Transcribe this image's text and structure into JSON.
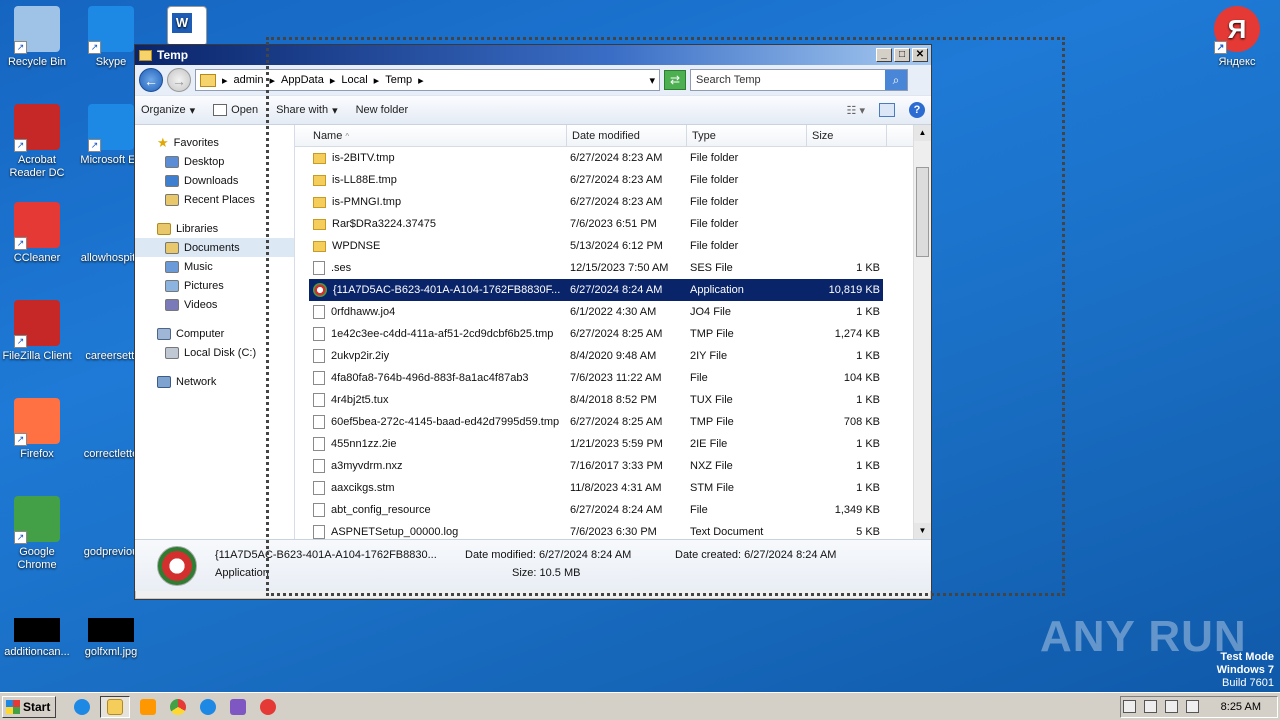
{
  "desktop": {
    "icons_left": [
      {
        "label": "Recycle Bin",
        "icon": "recycle-bin-icon",
        "color": "#9ec3e6"
      },
      {
        "label": "Acrobat Reader DC",
        "icon": "acrobat-icon",
        "color": "#c62828"
      },
      {
        "label": "CCleaner",
        "icon": "ccleaner-icon",
        "color": "#e53935"
      },
      {
        "label": "FileZilla Client",
        "icon": "filezilla-icon",
        "color": "#c62828"
      },
      {
        "label": "Firefox",
        "icon": "firefox-icon",
        "color": "#ff7043"
      },
      {
        "label": "Google Chrome",
        "icon": "chrome-icon",
        "color": "#43a047"
      },
      {
        "label": "additioncan...",
        "icon": "image-thumb-icon",
        "color": "#000000"
      }
    ],
    "icons_col2": [
      {
        "label": "Skype",
        "icon": "skype-icon",
        "color": "#1e88e5"
      },
      {
        "label": "Microsoft Ed",
        "icon": "edge-icon",
        "color": "#1e88e5"
      },
      {
        "label": "allowhospita",
        "icon": "file-icon",
        "color": "#1e78d0"
      },
      {
        "label": "careersetti",
        "icon": "file-icon",
        "color": "#1e78d0"
      },
      {
        "label": "correctlette",
        "icon": "file-icon",
        "color": "#1e78d0"
      },
      {
        "label": "godpreviou",
        "icon": "file-icon",
        "color": "#1e78d0"
      },
      {
        "label": "golfxml.jpg",
        "icon": "image-thumb-icon",
        "color": "#000000"
      }
    ],
    "icon_right": {
      "label": "Яндекс",
      "icon": "yandex-icon",
      "color": "#e53935"
    },
    "word_icon": "word-icon"
  },
  "window": {
    "title": "Temp",
    "breadcrumb": [
      "admin",
      "AppData",
      "Local",
      "Temp"
    ],
    "search_placeholder": "Search Temp",
    "toolbar": {
      "organize": "Organize",
      "open": "Open",
      "share": "Share with",
      "new_folder": "New folder"
    },
    "nav": {
      "favorites": "Favorites",
      "favorites_items": [
        "Desktop",
        "Downloads",
        "Recent Places"
      ],
      "libraries": "Libraries",
      "libraries_items": [
        "Documents",
        "Music",
        "Pictures",
        "Videos"
      ],
      "computer": "Computer",
      "computer_items": [
        "Local Disk (C:)"
      ],
      "network": "Network"
    },
    "columns": {
      "name": "Name",
      "date": "Date modified",
      "type": "Type",
      "size": "Size"
    },
    "files": [
      {
        "name": "is-2BITV.tmp",
        "date": "6/27/2024 8:23 AM",
        "type": "File folder",
        "size": "",
        "kind": "folder"
      },
      {
        "name": "is-LL88E.tmp",
        "date": "6/27/2024 8:23 AM",
        "type": "File folder",
        "size": "",
        "kind": "folder"
      },
      {
        "name": "is-PMNGI.tmp",
        "date": "6/27/2024 8:23 AM",
        "type": "File folder",
        "size": "",
        "kind": "folder"
      },
      {
        "name": "Rar$DRa3224.37475",
        "date": "7/6/2023 6:51 PM",
        "type": "File folder",
        "size": "",
        "kind": "folder"
      },
      {
        "name": "WPDNSE",
        "date": "5/13/2024 6:12 PM",
        "type": "File folder",
        "size": "",
        "kind": "folder"
      },
      {
        "name": ".ses",
        "date": "12/15/2023 7:50 AM",
        "type": "SES File",
        "size": "1 KB",
        "kind": "file"
      },
      {
        "name": "{11A7D5AC-B623-401A-A104-1762FB8830F...",
        "date": "6/27/2024 8:24 AM",
        "type": "Application",
        "size": "10,819 KB",
        "kind": "app",
        "selected": true
      },
      {
        "name": "0rfdhaww.jo4",
        "date": "6/1/2022 4:30 AM",
        "type": "JO4 File",
        "size": "1 KB",
        "kind": "file"
      },
      {
        "name": "1e42c3ee-c4dd-411a-af51-2cd9dcbf6b25.tmp",
        "date": "6/27/2024 8:25 AM",
        "type": "TMP File",
        "size": "1,274 KB",
        "kind": "file"
      },
      {
        "name": "2ukvp2ir.2iy",
        "date": "8/4/2020 9:48 AM",
        "type": "2IY File",
        "size": "1 KB",
        "kind": "file"
      },
      {
        "name": "4fa80fa8-764b-496d-883f-8a1ac4f87ab3",
        "date": "7/6/2023 11:22 AM",
        "type": "File",
        "size": "104 KB",
        "kind": "file"
      },
      {
        "name": "4r4bj2t5.tux",
        "date": "8/4/2018 8:52 PM",
        "type": "TUX File",
        "size": "1 KB",
        "kind": "file"
      },
      {
        "name": "60ef5bea-272c-4145-baad-ed42d7995d59.tmp",
        "date": "6/27/2024 8:25 AM",
        "type": "TMP File",
        "size": "708 KB",
        "kind": "file"
      },
      {
        "name": "455nn1zz.2ie",
        "date": "1/21/2023 5:59 PM",
        "type": "2IE File",
        "size": "1 KB",
        "kind": "file"
      },
      {
        "name": "a3myvdrm.nxz",
        "date": "7/16/2017 3:33 PM",
        "type": "NXZ File",
        "size": "1 KB",
        "kind": "file"
      },
      {
        "name": "aaxcikgs.stm",
        "date": "11/8/2023 4:31 AM",
        "type": "STM File",
        "size": "1 KB",
        "kind": "file"
      },
      {
        "name": "abt_config_resource",
        "date": "6/27/2024 8:24 AM",
        "type": "File",
        "size": "1,349 KB",
        "kind": "file"
      },
      {
        "name": "ASPNETSetup_00000.log",
        "date": "7/6/2023 6:30 PM",
        "type": "Text Document",
        "size": "5 KB",
        "kind": "file"
      }
    ],
    "details": {
      "name": "{11A7D5AC-B623-401A-A104-1762FB8830...",
      "type": "Application",
      "date_modified": "Date modified: 6/27/2024 8:24 AM",
      "date_created": "Date created: 6/27/2024 8:24 AM",
      "size": "Size: 10.5 MB"
    }
  },
  "taskbar": {
    "start": "Start",
    "apps": [
      "ie-icon",
      "explorer-icon",
      "media-player-icon",
      "chrome-icon",
      "edge-icon",
      "vpn-icon",
      "yandex-icon"
    ],
    "clock": "8:25 AM"
  },
  "watermark": {
    "line1": "Test Mode",
    "line2": "Windows 7",
    "line3": "Build 7601",
    "brand": "ANY RUN"
  }
}
